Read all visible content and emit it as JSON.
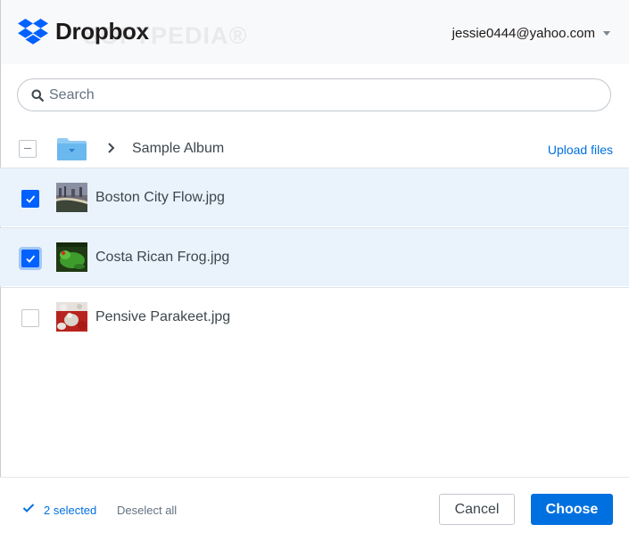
{
  "header": {
    "brand": "Dropbox",
    "watermark": "SOFTPEDIA®",
    "account_email": "jessie0444@yahoo.com"
  },
  "search": {
    "placeholder": "Search"
  },
  "breadcrumb": {
    "folder_icon": "folder-icon",
    "current_folder": "Sample Album",
    "upload_label": "Upload files"
  },
  "files": [
    {
      "name": "Boston City Flow.jpg",
      "checked": true,
      "focused": false
    },
    {
      "name": "Costa Rican Frog.jpg",
      "checked": true,
      "focused": true
    },
    {
      "name": "Pensive Parakeet.jpg",
      "checked": false,
      "focused": false
    }
  ],
  "footer": {
    "selected_text": "2 selected",
    "deselect_label": "Deselect all",
    "cancel_label": "Cancel",
    "choose_label": "Choose"
  },
  "colors": {
    "accent": "#0070e0",
    "selected_row": "#eaf3fc",
    "brand_blue": "#0061fe"
  }
}
